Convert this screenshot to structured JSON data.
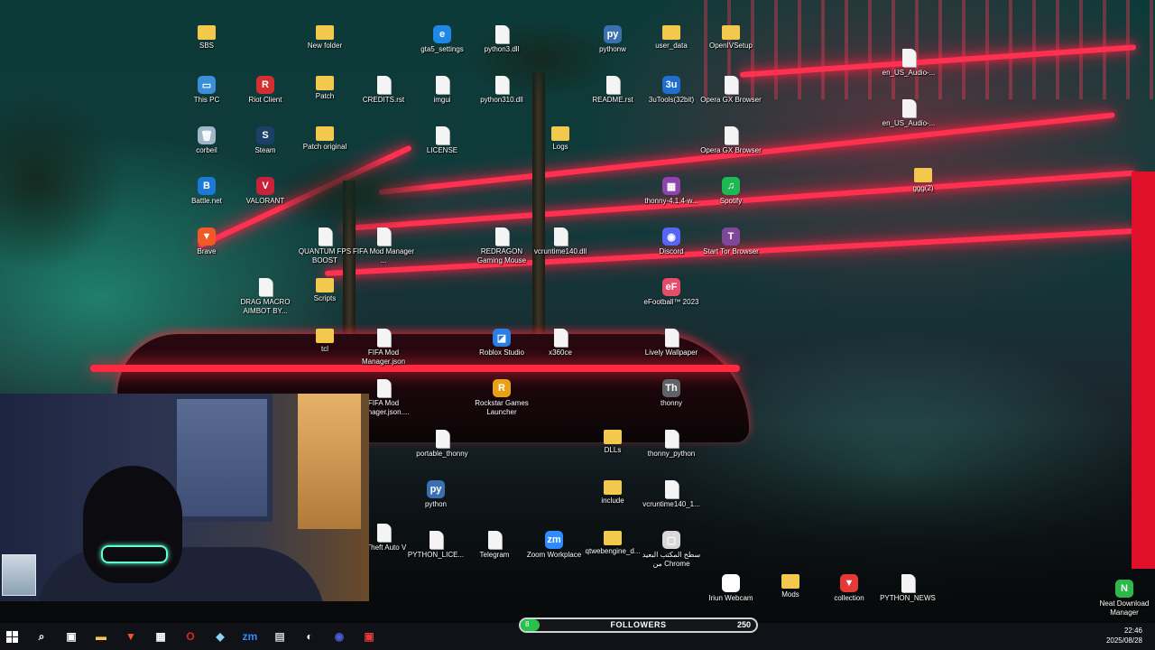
{
  "desktop": {
    "icons": [
      {
        "label": "SBS",
        "type": "folder",
        "color": "#f2c94c",
        "glyph": ""
      },
      {
        "label": "This PC",
        "type": "app",
        "color": "#3a8fd8",
        "glyph": "▭"
      },
      {
        "label": "corbeil",
        "type": "app",
        "color": "#9fb7c9",
        "glyph": "🗑"
      },
      {
        "label": "Battle.net",
        "type": "app",
        "color": "#1e78d6",
        "glyph": "B"
      },
      {
        "label": "Brave",
        "type": "app",
        "color": "#f15a24",
        "glyph": "▼"
      },
      {
        "label": "Riot Client",
        "type": "app",
        "color": "#d32f2f",
        "glyph": "R"
      },
      {
        "label": "Steam",
        "type": "app",
        "color": "#1b3f66",
        "glyph": "S"
      },
      {
        "label": "VALORANT",
        "type": "app",
        "color": "#c8223a",
        "glyph": "V"
      },
      {
        "label": "DRAG MACRO AIMBOT BY...",
        "type": "file",
        "color": "#f4f4f4",
        "glyph": ""
      },
      {
        "label": "New folder",
        "type": "folder",
        "color": "#f2c94c",
        "glyph": ""
      },
      {
        "label": "Patch",
        "type": "folder",
        "color": "#f2c94c",
        "glyph": ""
      },
      {
        "label": "Patch original",
        "type": "folder",
        "color": "#f2c94c",
        "glyph": ""
      },
      {
        "label": "QUANTUM FPS BOOST",
        "type": "file",
        "color": "#f4f4f4",
        "glyph": ""
      },
      {
        "label": "Scripts",
        "type": "folder",
        "color": "#f2c94c",
        "glyph": ""
      },
      {
        "label": "tcl",
        "type": "folder",
        "color": "#f2c94c",
        "glyph": ""
      },
      {
        "label": "CREDITS.rst",
        "type": "file",
        "color": "#f4f4f4",
        "glyph": ""
      },
      {
        "label": "FIFA Mod Manager ...",
        "type": "file",
        "color": "#f4f4f4",
        "glyph": ""
      },
      {
        "label": "FIFA Mod Manager.json",
        "type": "file",
        "color": "#f4f4f4",
        "glyph": ""
      },
      {
        "label": "FIFA Mod Manager.json....",
        "type": "file",
        "color": "#f4f4f4",
        "glyph": ""
      },
      {
        "label": "d Theft Auto V",
        "type": "file",
        "color": "#f4f4f4",
        "glyph": ""
      },
      {
        "label": "gta5_settings",
        "type": "app",
        "color": "#1e88e5",
        "glyph": "e"
      },
      {
        "label": "imgui",
        "type": "file",
        "color": "#f4f4f4",
        "glyph": ""
      },
      {
        "label": "LICENSE",
        "type": "file",
        "color": "#f4f4f4",
        "glyph": ""
      },
      {
        "label": "portable_thonny",
        "type": "file",
        "color": "#f4f4f4",
        "glyph": ""
      },
      {
        "label": "python",
        "type": "app",
        "color": "#3a6fb0",
        "glyph": "py"
      },
      {
        "label": "PYTHON_LICE...",
        "type": "file",
        "color": "#f4f4f4",
        "glyph": ""
      },
      {
        "label": "python3.dll",
        "type": "file",
        "color": "#f4f4f4",
        "glyph": ""
      },
      {
        "label": "python310.dll",
        "type": "file",
        "color": "#f4f4f4",
        "glyph": ""
      },
      {
        "label": "REDRAGON Gaming Mouse",
        "type": "file",
        "color": "#f4f4f4",
        "glyph": ""
      },
      {
        "label": "Roblox Studio",
        "type": "app",
        "color": "#2a7de1",
        "glyph": "◪"
      },
      {
        "label": "Rockstar Games Launcher",
        "type": "app",
        "color": "#e8a017",
        "glyph": "R"
      },
      {
        "label": "Telegram",
        "type": "file",
        "color": "#f4f4f4",
        "glyph": ""
      },
      {
        "label": "Logs",
        "type": "folder",
        "color": "#f2c94c",
        "glyph": ""
      },
      {
        "label": "vcruntime140.dll",
        "type": "file",
        "color": "#f4f4f4",
        "glyph": ""
      },
      {
        "label": "x360ce",
        "type": "file",
        "color": "#f4f4f4",
        "glyph": ""
      },
      {
        "label": "Zoom Workplace",
        "type": "app",
        "color": "#2d8cff",
        "glyph": "zm"
      },
      {
        "label": "pythonw",
        "type": "app",
        "color": "#3a6fb0",
        "glyph": "py"
      },
      {
        "label": "README.rst",
        "type": "file",
        "color": "#f4f4f4",
        "glyph": ""
      },
      {
        "label": "DLLs",
        "type": "folder",
        "color": "#f2c94c",
        "glyph": ""
      },
      {
        "label": "include",
        "type": "folder",
        "color": "#f2c94c",
        "glyph": ""
      },
      {
        "label": "qtwebengine_d...",
        "type": "folder",
        "color": "#f2c94c",
        "glyph": ""
      },
      {
        "label": "user_data",
        "type": "folder",
        "color": "#f2c94c",
        "glyph": ""
      },
      {
        "label": "3uTools(32bit)",
        "type": "app",
        "color": "#1f6fd1",
        "glyph": "3u"
      },
      {
        "label": "thonny-4.1.4-w...",
        "type": "app",
        "color": "#8e44ad",
        "glyph": "▦"
      },
      {
        "label": "Discord",
        "type": "app",
        "color": "#5865f2",
        "glyph": "◉"
      },
      {
        "label": "eFootball™ 2023",
        "type": "app",
        "color": "#e94b6b",
        "glyph": "eF"
      },
      {
        "label": "Lively Wallpaper",
        "type": "file",
        "color": "#f4f4f4",
        "glyph": ""
      },
      {
        "label": "thonny",
        "type": "app",
        "color": "#5f6368",
        "glyph": "Th"
      },
      {
        "label": "thonny_python",
        "type": "file",
        "color": "#f4f4f4",
        "glyph": ""
      },
      {
        "label": "vcruntime140_1...",
        "type": "file",
        "color": "#f4f4f4",
        "glyph": ""
      },
      {
        "label": "سطح المكتب البعيد من Chrome",
        "type": "app",
        "color": "#d8d8d8",
        "glyph": "▢"
      },
      {
        "label": "OpenIVSetup",
        "type": "folder",
        "color": "#f2c94c",
        "glyph": ""
      },
      {
        "label": "Opera GX Browser",
        "type": "file",
        "color": "#f4f4f4",
        "glyph": ""
      },
      {
        "label": "Opera GX Browser",
        "type": "file",
        "color": "#f4f4f4",
        "glyph": ""
      },
      {
        "label": "Spotify",
        "type": "app",
        "color": "#1db954",
        "glyph": "♫"
      },
      {
        "label": "Start Tor Browser",
        "type": "app",
        "color": "#7e4798",
        "glyph": "T"
      },
      {
        "label": "Iriun Webcam",
        "type": "app",
        "color": "#ffffff",
        "glyph": "◎"
      },
      {
        "label": "Mods",
        "type": "folder",
        "color": "#f2c94c",
        "glyph": ""
      },
      {
        "label": "collection",
        "type": "app",
        "color": "#e53935",
        "glyph": "▼"
      },
      {
        "label": "PYTHON_NEWS",
        "type": "file",
        "color": "#f4f4f4",
        "glyph": ""
      },
      {
        "label": "en_US_Audio-...",
        "type": "file",
        "color": "#f4f4f4",
        "glyph": ""
      },
      {
        "label": "en_US_Audio-...",
        "type": "file",
        "color": "#f4f4f4",
        "glyph": ""
      },
      {
        "label": "ggg(2)",
        "type": "folder",
        "color": "#f2c94c",
        "glyph": ""
      },
      {
        "label": "Neat Download Manager",
        "type": "app",
        "color": "#2eb84b",
        "glyph": "N"
      }
    ]
  },
  "overlay": {
    "followers_label": "FOLLOWERS",
    "followers_current": "8",
    "followers_goal": "250",
    "progress_fraction": 0.032,
    "accent": "#27c24c"
  },
  "taskbar": {
    "items": [
      {
        "name": "start-icon",
        "glyph": "",
        "color": "#ffffff"
      },
      {
        "name": "search-icon",
        "glyph": "⌕",
        "color": "#ffffff"
      },
      {
        "name": "task-view-icon",
        "glyph": "▣",
        "color": "#ffffff"
      },
      {
        "name": "file-explorer-icon",
        "glyph": "▬",
        "color": "#f2c94c"
      },
      {
        "name": "brave-icon",
        "glyph": "▼",
        "color": "#f15a24"
      },
      {
        "name": "store-icon",
        "glyph": "▦",
        "color": "#ffffff"
      },
      {
        "name": "opera-icon",
        "glyph": "O",
        "color": "#e1251b"
      },
      {
        "name": "thonny-taskbar-icon",
        "glyph": "◆",
        "color": "#8fd3f4"
      },
      {
        "name": "zoom-taskbar-icon",
        "glyph": "zm",
        "color": "#2d8cff"
      },
      {
        "name": "app-window-icon",
        "glyph": "▤",
        "color": "#d0d0d0"
      },
      {
        "name": "steam-taskbar-icon",
        "glyph": "◐",
        "color": "#ffffff"
      },
      {
        "name": "chrome-remote-icon",
        "glyph": "◉",
        "color": "#4a5fd6"
      },
      {
        "name": "red-app-icon",
        "glyph": "▣",
        "color": "#e53935"
      }
    ],
    "time": "22:46",
    "date": "2025/08/28"
  }
}
